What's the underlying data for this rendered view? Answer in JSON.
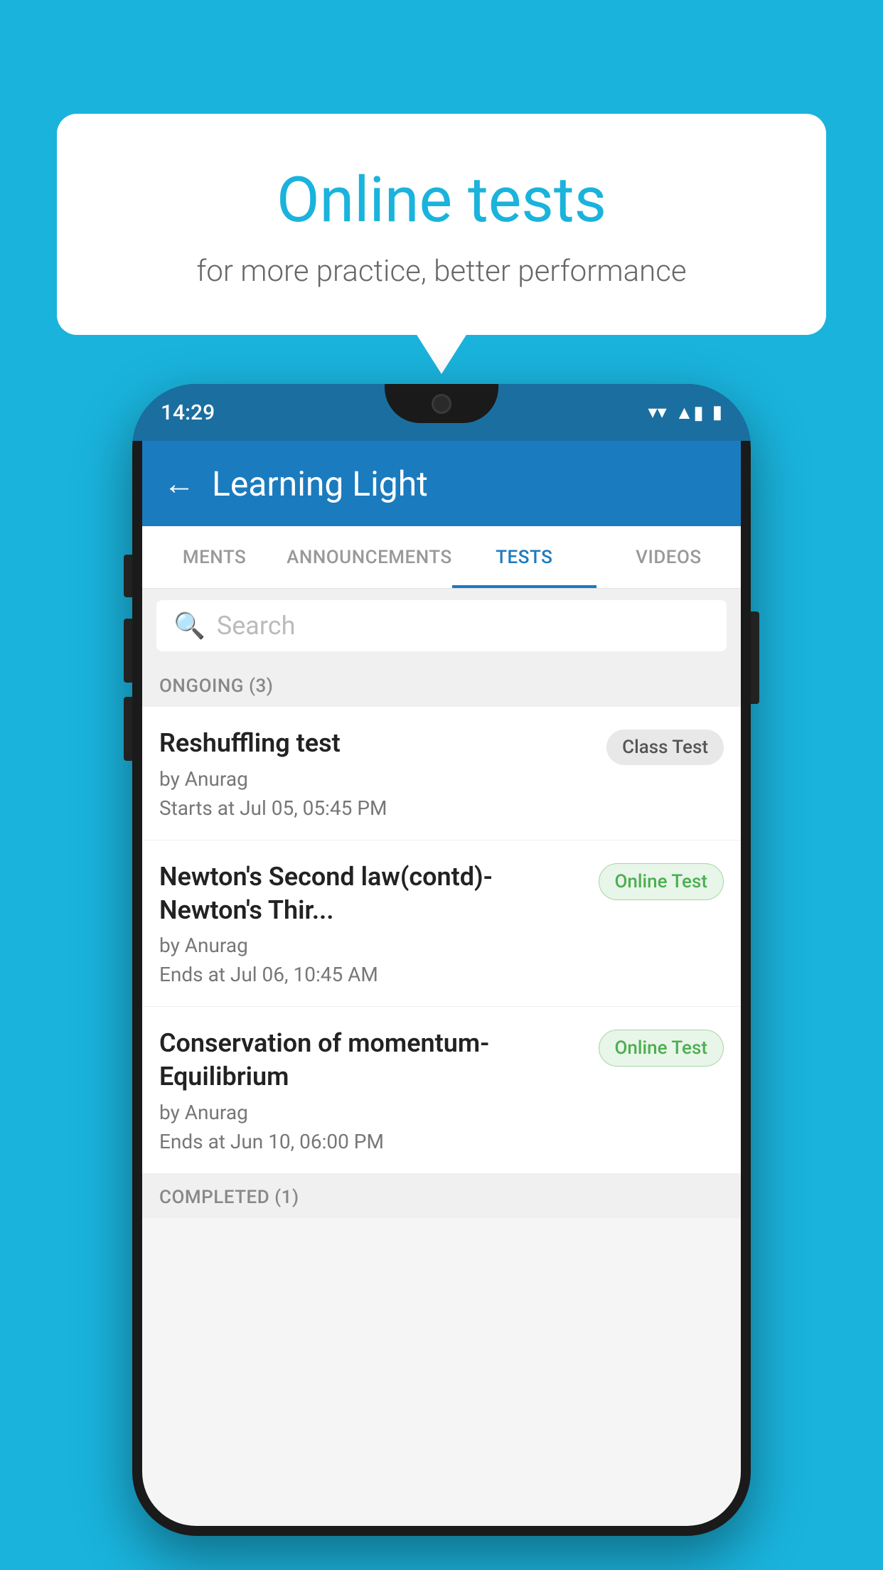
{
  "background_color": "#1ab3dc",
  "speech_bubble": {
    "title": "Online tests",
    "subtitle": "for more practice, better performance"
  },
  "phone": {
    "status_bar": {
      "time": "14:29",
      "wifi": "▼",
      "signal": "▲",
      "battery": "▮"
    },
    "header": {
      "title": "Learning Light",
      "back_label": "←"
    },
    "tabs": [
      {
        "label": "MENTS",
        "active": false
      },
      {
        "label": "ANNOUNCEMENTS",
        "active": false
      },
      {
        "label": "TESTS",
        "active": true
      },
      {
        "label": "VIDEOS",
        "active": false
      }
    ],
    "search": {
      "placeholder": "Search"
    },
    "ongoing_section": {
      "label": "ONGOING (3)"
    },
    "tests": [
      {
        "name": "Reshuffling test",
        "author": "by Anurag",
        "date": "Starts at  Jul 05, 05:45 PM",
        "badge": "Class Test",
        "badge_type": "class"
      },
      {
        "name": "Newton's Second law(contd)-Newton's Thir...",
        "author": "by Anurag",
        "date": "Ends at  Jul 06, 10:45 AM",
        "badge": "Online Test",
        "badge_type": "online"
      },
      {
        "name": "Conservation of momentum-Equilibrium",
        "author": "by Anurag",
        "date": "Ends at  Jun 10, 06:00 PM",
        "badge": "Online Test",
        "badge_type": "online"
      }
    ],
    "completed_section": {
      "label": "COMPLETED (1)"
    }
  }
}
